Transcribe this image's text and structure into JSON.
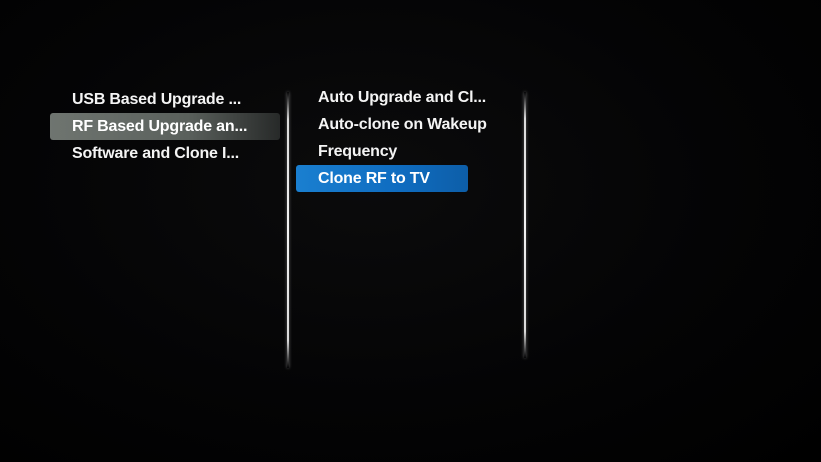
{
  "menu": {
    "column1": {
      "items": [
        {
          "label": "USB Based Upgrade ..."
        },
        {
          "label": "RF Based Upgrade an..."
        },
        {
          "label": "Software and Clone I..."
        }
      ],
      "selected_index": 1
    },
    "column2": {
      "items": [
        {
          "label": "Auto Upgrade and Cl..."
        },
        {
          "label": "Auto-clone on Wakeup"
        },
        {
          "label": "Frequency"
        },
        {
          "label": "Clone RF to TV"
        }
      ],
      "focused_index": 3
    },
    "column3": {
      "items": []
    }
  },
  "colors": {
    "focus_highlight": "#1a7fd0",
    "parent_highlight": "#6f7570",
    "background": "#000000",
    "text": "#f4f4f4"
  }
}
